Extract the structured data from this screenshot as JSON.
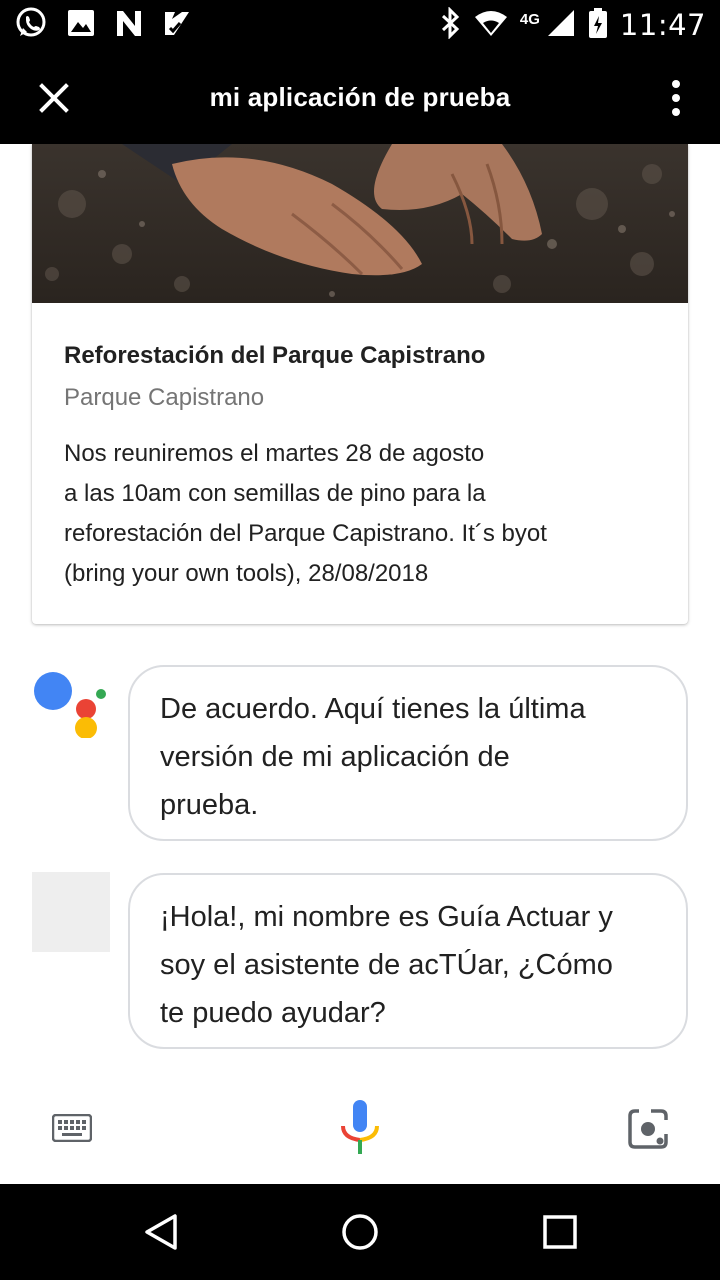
{
  "status_bar": {
    "time": "11:47",
    "network": "4G",
    "icons": [
      "whatsapp-icon",
      "image-icon",
      "n-icon",
      "notification-check-icon",
      "bluetooth-icon",
      "wifi-icon",
      "signal-icon",
      "battery-icon"
    ]
  },
  "app_bar": {
    "title": "mi aplicación de prueba",
    "close_icon": "close-icon",
    "more_icon": "more-vert-icon"
  },
  "card": {
    "title": "Reforestación del Parque Capistrano",
    "subtitle": "Parque Capistrano",
    "body_lines": [
      "Nos reuniremos el martes 28 de agosto",
      "a las 10am con semillas de pino para la",
      "reforestación del Parque Capistrano. It´s byot",
      "(bring your own tools), 28/08/2018"
    ]
  },
  "conversation": [
    {
      "speaker": "assistant",
      "lines": [
        "De acuerdo. Aquí tienes la última",
        "versión de mi aplicación de",
        "prueba."
      ]
    },
    {
      "speaker": "app",
      "lines": [
        "¡Hola!, mi nombre es Guía Actuar y",
        "soy el asistente de acTÚar, ¿Cómo",
        "te puedo ayudar?"
      ]
    }
  ],
  "input_bar": {
    "keyboard_icon": "keyboard-icon",
    "mic_icon": "mic-icon",
    "lens_icon": "lens-icon"
  },
  "nav_bar": {
    "icons": [
      "back-icon",
      "home-icon",
      "recents-icon"
    ]
  },
  "colors": {
    "google_blue": "#4285f4",
    "google_red": "#ea4335",
    "google_yellow": "#fbbc05",
    "google_green": "#34a853",
    "bubble_border": "#dadce0"
  }
}
